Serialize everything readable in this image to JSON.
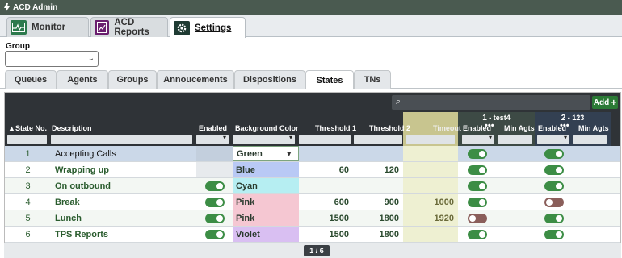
{
  "app": {
    "title": "ACD Admin"
  },
  "main_tabs": [
    {
      "label": "Monitor",
      "icon": "monitor-icon"
    },
    {
      "label": "ACD Reports",
      "icon": "report-icon"
    },
    {
      "label": "Settings",
      "icon": "gear-icon"
    }
  ],
  "group": {
    "label": "Group",
    "value": ""
  },
  "sub_tabs": [
    "Queues",
    "Agents",
    "Groups",
    "Annoucements",
    "Dispositions",
    "States",
    "TNs"
  ],
  "toolbar": {
    "search_value": "",
    "add_label": "Add"
  },
  "columns": {
    "state_no": "State No.",
    "description": "Description",
    "enabled": "Enabled",
    "background_color": "Background Color",
    "threshold1": "Threshold 1",
    "threshold2": "Threshold 2",
    "timeout": "Timeout",
    "g1_enabled": "Enabled",
    "g1_min": "Min Agts",
    "g2_enabled": "Enabled",
    "g2_min": "Min Agts"
  },
  "groups": [
    {
      "num": "1",
      "name": "test4"
    },
    {
      "num": "2",
      "name": "123"
    }
  ],
  "colors": {
    "Green": "#f4f6f8",
    "Blue": "#b9c9f5",
    "Cyan": "#b6eef2",
    "Pink": "#f5c7d2",
    "Violet": "#d9bff2"
  },
  "rows": [
    {
      "no": "1",
      "desc": "Accepting Calls",
      "enabled": null,
      "color": "Green",
      "t1": "",
      "t2": "",
      "timeout": "",
      "g1_enabled": true,
      "g1_min": "",
      "g2_enabled": true,
      "g2_min": ""
    },
    {
      "no": "2",
      "desc": "Wrapping up",
      "enabled": null,
      "color": "Blue",
      "t1": "60",
      "t2": "120",
      "timeout": "",
      "g1_enabled": true,
      "g1_min": "",
      "g2_enabled": true,
      "g2_min": ""
    },
    {
      "no": "3",
      "desc": "On outbound",
      "enabled": true,
      "color": "Cyan",
      "t1": "",
      "t2": "",
      "timeout": "",
      "g1_enabled": true,
      "g1_min": "",
      "g2_enabled": true,
      "g2_min": ""
    },
    {
      "no": "4",
      "desc": "Break",
      "enabled": true,
      "color": "Pink",
      "t1": "600",
      "t2": "900",
      "timeout": "1000",
      "g1_enabled": true,
      "g1_min": "",
      "g2_enabled": false,
      "g2_min": ""
    },
    {
      "no": "5",
      "desc": "Lunch",
      "enabled": true,
      "color": "Pink",
      "t1": "1500",
      "t2": "1800",
      "timeout": "1920",
      "g1_enabled": false,
      "g1_min": "",
      "g2_enabled": true,
      "g2_min": ""
    },
    {
      "no": "6",
      "desc": "TPS Reports",
      "enabled": true,
      "color": "Violet",
      "t1": "1500",
      "t2": "1800",
      "timeout": "",
      "g1_enabled": true,
      "g1_min": "",
      "g2_enabled": true,
      "g2_min": ""
    }
  ],
  "pager": {
    "text": "1 / 6"
  }
}
